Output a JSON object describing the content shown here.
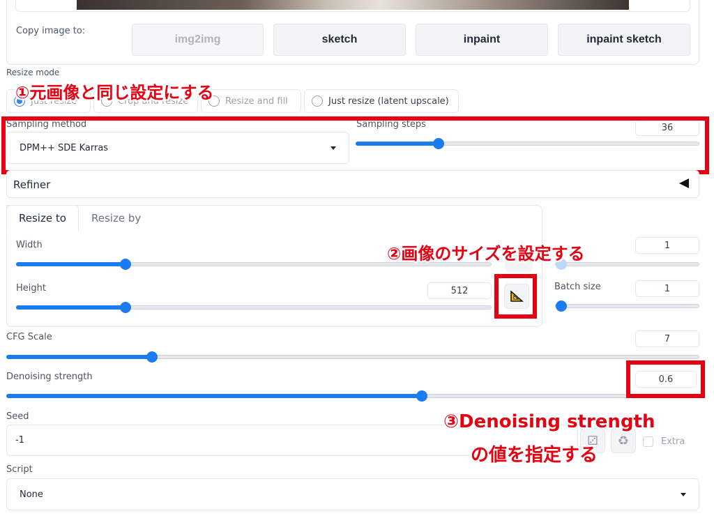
{
  "copy_image": {
    "label": "Copy image to:",
    "buttons": [
      "img2img",
      "sketch",
      "inpaint",
      "inpaint sketch"
    ]
  },
  "resize_mode": {
    "label": "Resize mode",
    "options": [
      "Just resize",
      "Crop and resize",
      "Resize and fill",
      "Just resize (latent upscale)"
    ],
    "selected": "Just resize"
  },
  "sampling": {
    "method_label": "Sampling method",
    "method_value": "DPM++ SDE Karras",
    "steps_label": "Sampling steps",
    "steps_value": "36",
    "steps_fraction": 0.24
  },
  "refiner": {
    "label": "Refiner",
    "icon": "triangle-left-icon"
  },
  "size_tabs": {
    "tabs": [
      "Resize to",
      "Resize by"
    ],
    "active": "Resize to",
    "width_label": "Width",
    "width_fraction": 0.23,
    "height_label": "Height",
    "height_value": "512",
    "height_fraction": 0.23,
    "swap_icon": "triangle-ruler-icon"
  },
  "batch": {
    "count_value": "1",
    "size_label": "Batch size",
    "size_value": "1"
  },
  "cfg": {
    "label": "CFG Scale",
    "value": "7",
    "fraction": 0.21
  },
  "denoise": {
    "label": "Denoising strength",
    "value": "0.6",
    "fraction": 0.6
  },
  "seed": {
    "label": "Seed",
    "value": "-1",
    "extra_label": "Extra"
  },
  "script": {
    "label": "Script",
    "value": "None"
  },
  "annotations": {
    "a1": "①元画像と同じ設定にする",
    "a2": "②画像のサイズを設定する",
    "a3_line1": "③Denoising strength",
    "a3_line2": "の値を指定する"
  },
  "colors": {
    "accent": "#1b7cf2",
    "annotation_red": "#e50012"
  }
}
